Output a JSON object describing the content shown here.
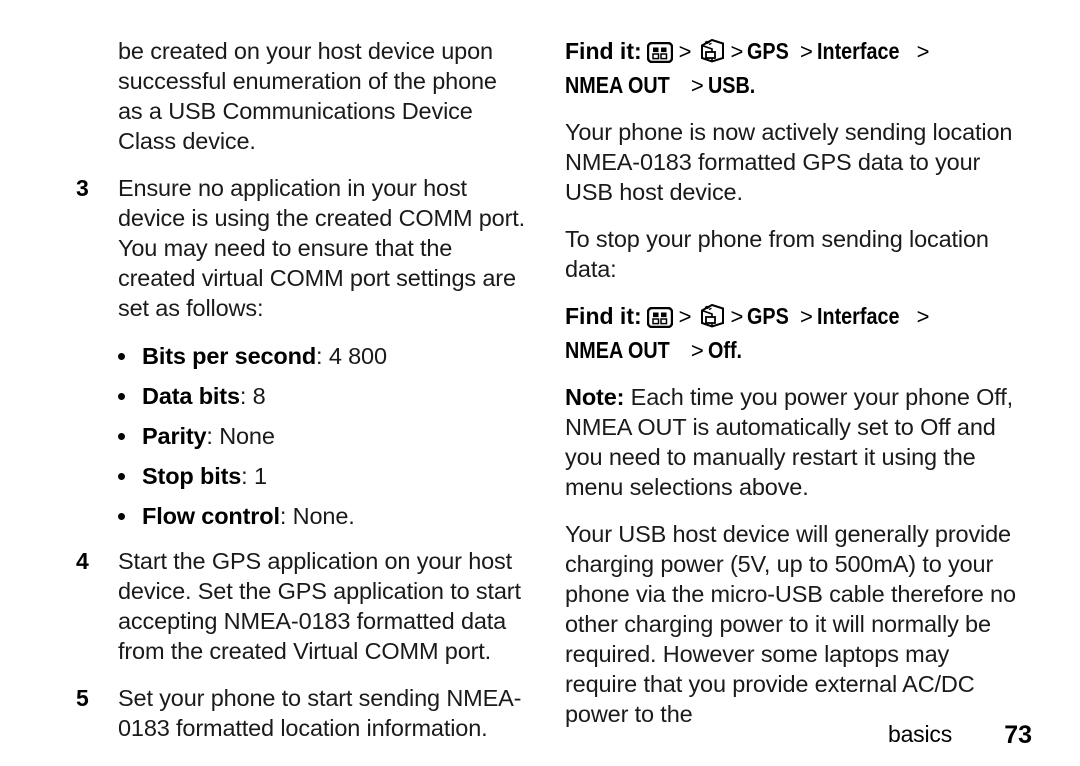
{
  "document": {
    "type": "phone-user-guide-page",
    "background_color": "#ffffff",
    "text_color": "#1a1a1a"
  },
  "left_column": {
    "continued_paragraph": "be created on your host device upon successful enumeration of the phone as a USB Communications Device Class device.",
    "step3": {
      "number": "3",
      "text": "Ensure no application in your host device is using the created COMM port. You may need to ensure that the created virtual COMM port settings are set as follows:"
    },
    "settings_bullets": [
      {
        "label": "Bits per second",
        "separator": ": ",
        "value": "4 800"
      },
      {
        "label": "Data bits",
        "separator": ": ",
        "value": "8"
      },
      {
        "label": "Parity",
        "separator": ": ",
        "value": "None"
      },
      {
        "label": "Stop bits",
        "separator": ": ",
        "value": "1"
      },
      {
        "label": "Flow control",
        "separator": ": ",
        "value": "None."
      }
    ],
    "step4": {
      "number": "4",
      "text": "Start the GPS application on your host device. Set the GPS application to start accepting NMEA-0183 formatted data from the created Virtual COMM port."
    },
    "step5": {
      "number": "5",
      "text": "Set your phone to start sending NMEA-0183 formatted location information."
    }
  },
  "right_column": {
    "findit_usb": {
      "label": "Find it:",
      "icons": [
        "main-menu-icon",
        "settings-folder-icon"
      ],
      "separator": ">",
      "crumbs": [
        "GPS",
        "Interface",
        "NMEA OUT",
        "USB."
      ]
    },
    "paragraph_sending": "Your phone is now actively sending location NMEA-0183 formatted GPS data to your USB host device.",
    "paragraph_stop": "To stop your phone from sending location data:",
    "findit_off": {
      "label": "Find it:",
      "icons": [
        "main-menu-icon",
        "settings-folder-icon"
      ],
      "separator": ">",
      "crumbs": [
        "GPS",
        "Interface",
        "NMEA OUT",
        "Off."
      ]
    },
    "note": {
      "label": "Note:",
      "text": " Each time you power your phone Off, NMEA OUT is automatically set to Off and you need to manually restart it using the menu selections above."
    },
    "paragraph_power": "Your USB host device will generally provide charging power (5V, up to 500mA) to your phone via the micro-USB cable therefore no other charging power to it will normally be required. However some laptops may require that you provide external AC/DC power to the"
  },
  "footer": {
    "section_name": "basics",
    "page_number": "73"
  }
}
